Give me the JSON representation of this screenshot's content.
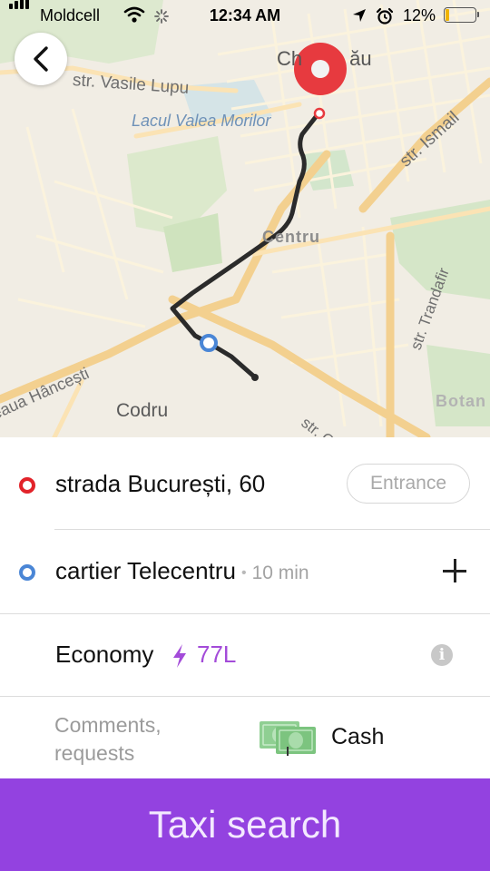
{
  "status_bar": {
    "carrier": "Moldcell",
    "time": "12:34 AM",
    "battery_percent": "12%",
    "battery_level": 0.12,
    "icons": [
      "signal-bars-icon",
      "wifi-icon",
      "activity-spinner-icon",
      "location-arrow-icon",
      "alarm-clock-icon",
      "battery-icon"
    ]
  },
  "map": {
    "labels": {
      "city_part": "Ch",
      "city_end": "ău",
      "street_vasile_lupu": "str. Vasile Lupu",
      "lake": "Lacul Valea Morilor",
      "street_ismail": "str. Ismail",
      "district_centru": "Centru",
      "street_trandafir": "str. Trandafir",
      "district_botanica": "Botan",
      "street_hancesti": "eaua Hâncești",
      "district_codru": "Codru",
      "street_g": "str. G"
    },
    "colors": {
      "background": "#f1ede4",
      "road": "#fbf3dd",
      "main_road": "#f6cf8e",
      "park": "#d5e6c8",
      "route": "#2b2b2b",
      "pickup_marker": "#e73a3f",
      "destination_marker": "#4a86d6"
    }
  },
  "back_button": {
    "icon": "chevron-left-icon"
  },
  "route": {
    "pickup": {
      "address": "strada București, 60",
      "entrance_label": "Entrance",
      "dot_color": "#e2232a"
    },
    "destination": {
      "address": "cartier Telecentru",
      "separator": "•",
      "eta": "10 min",
      "dot_color": "#4a86d6",
      "add_icon": "plus-icon"
    }
  },
  "tariff": {
    "name": "Economy",
    "price": "77L",
    "price_color": "#a34bd9",
    "surge_icon": "lightning-bolt-icon",
    "info_icon": "info-icon",
    "info_glyph": "i"
  },
  "options": {
    "comments_label": "Comments,\nrequests",
    "payment_icon": "cash-icon",
    "payment_label": "Cash"
  },
  "cta": {
    "label": "Taxi search",
    "color": "#9342e0"
  }
}
